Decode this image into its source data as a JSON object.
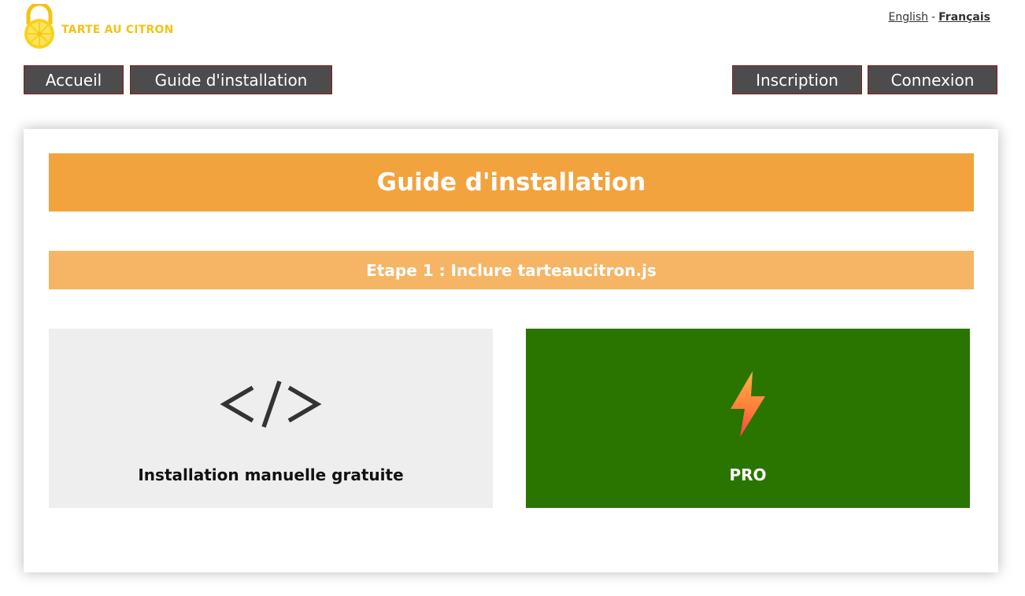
{
  "brand": {
    "logo_text": "TARTE AU CITRON",
    "logo_color": "#f3c316"
  },
  "language": {
    "english": "English",
    "separator": "-",
    "french": "Français",
    "active": "Français"
  },
  "nav": {
    "home": "Accueil",
    "guide": "Guide d'installation",
    "signup": "Inscription",
    "login": "Connexion"
  },
  "main": {
    "title": "Guide d'installation",
    "step": "Etape 1 : Inclure tarteaucitron.js",
    "options": [
      {
        "label": "Installation manuelle gratuite",
        "icon": "code-icon",
        "background": "#eeeeee"
      },
      {
        "label": "PRO",
        "icon": "lightning-bolt-icon",
        "background": "#2a7400"
      }
    ]
  },
  "colors": {
    "title_bar": "#f2a33e",
    "step_bar": "#f5b565",
    "nav_button": "#4c4c4c",
    "nav_border": "#8a1a1a"
  }
}
